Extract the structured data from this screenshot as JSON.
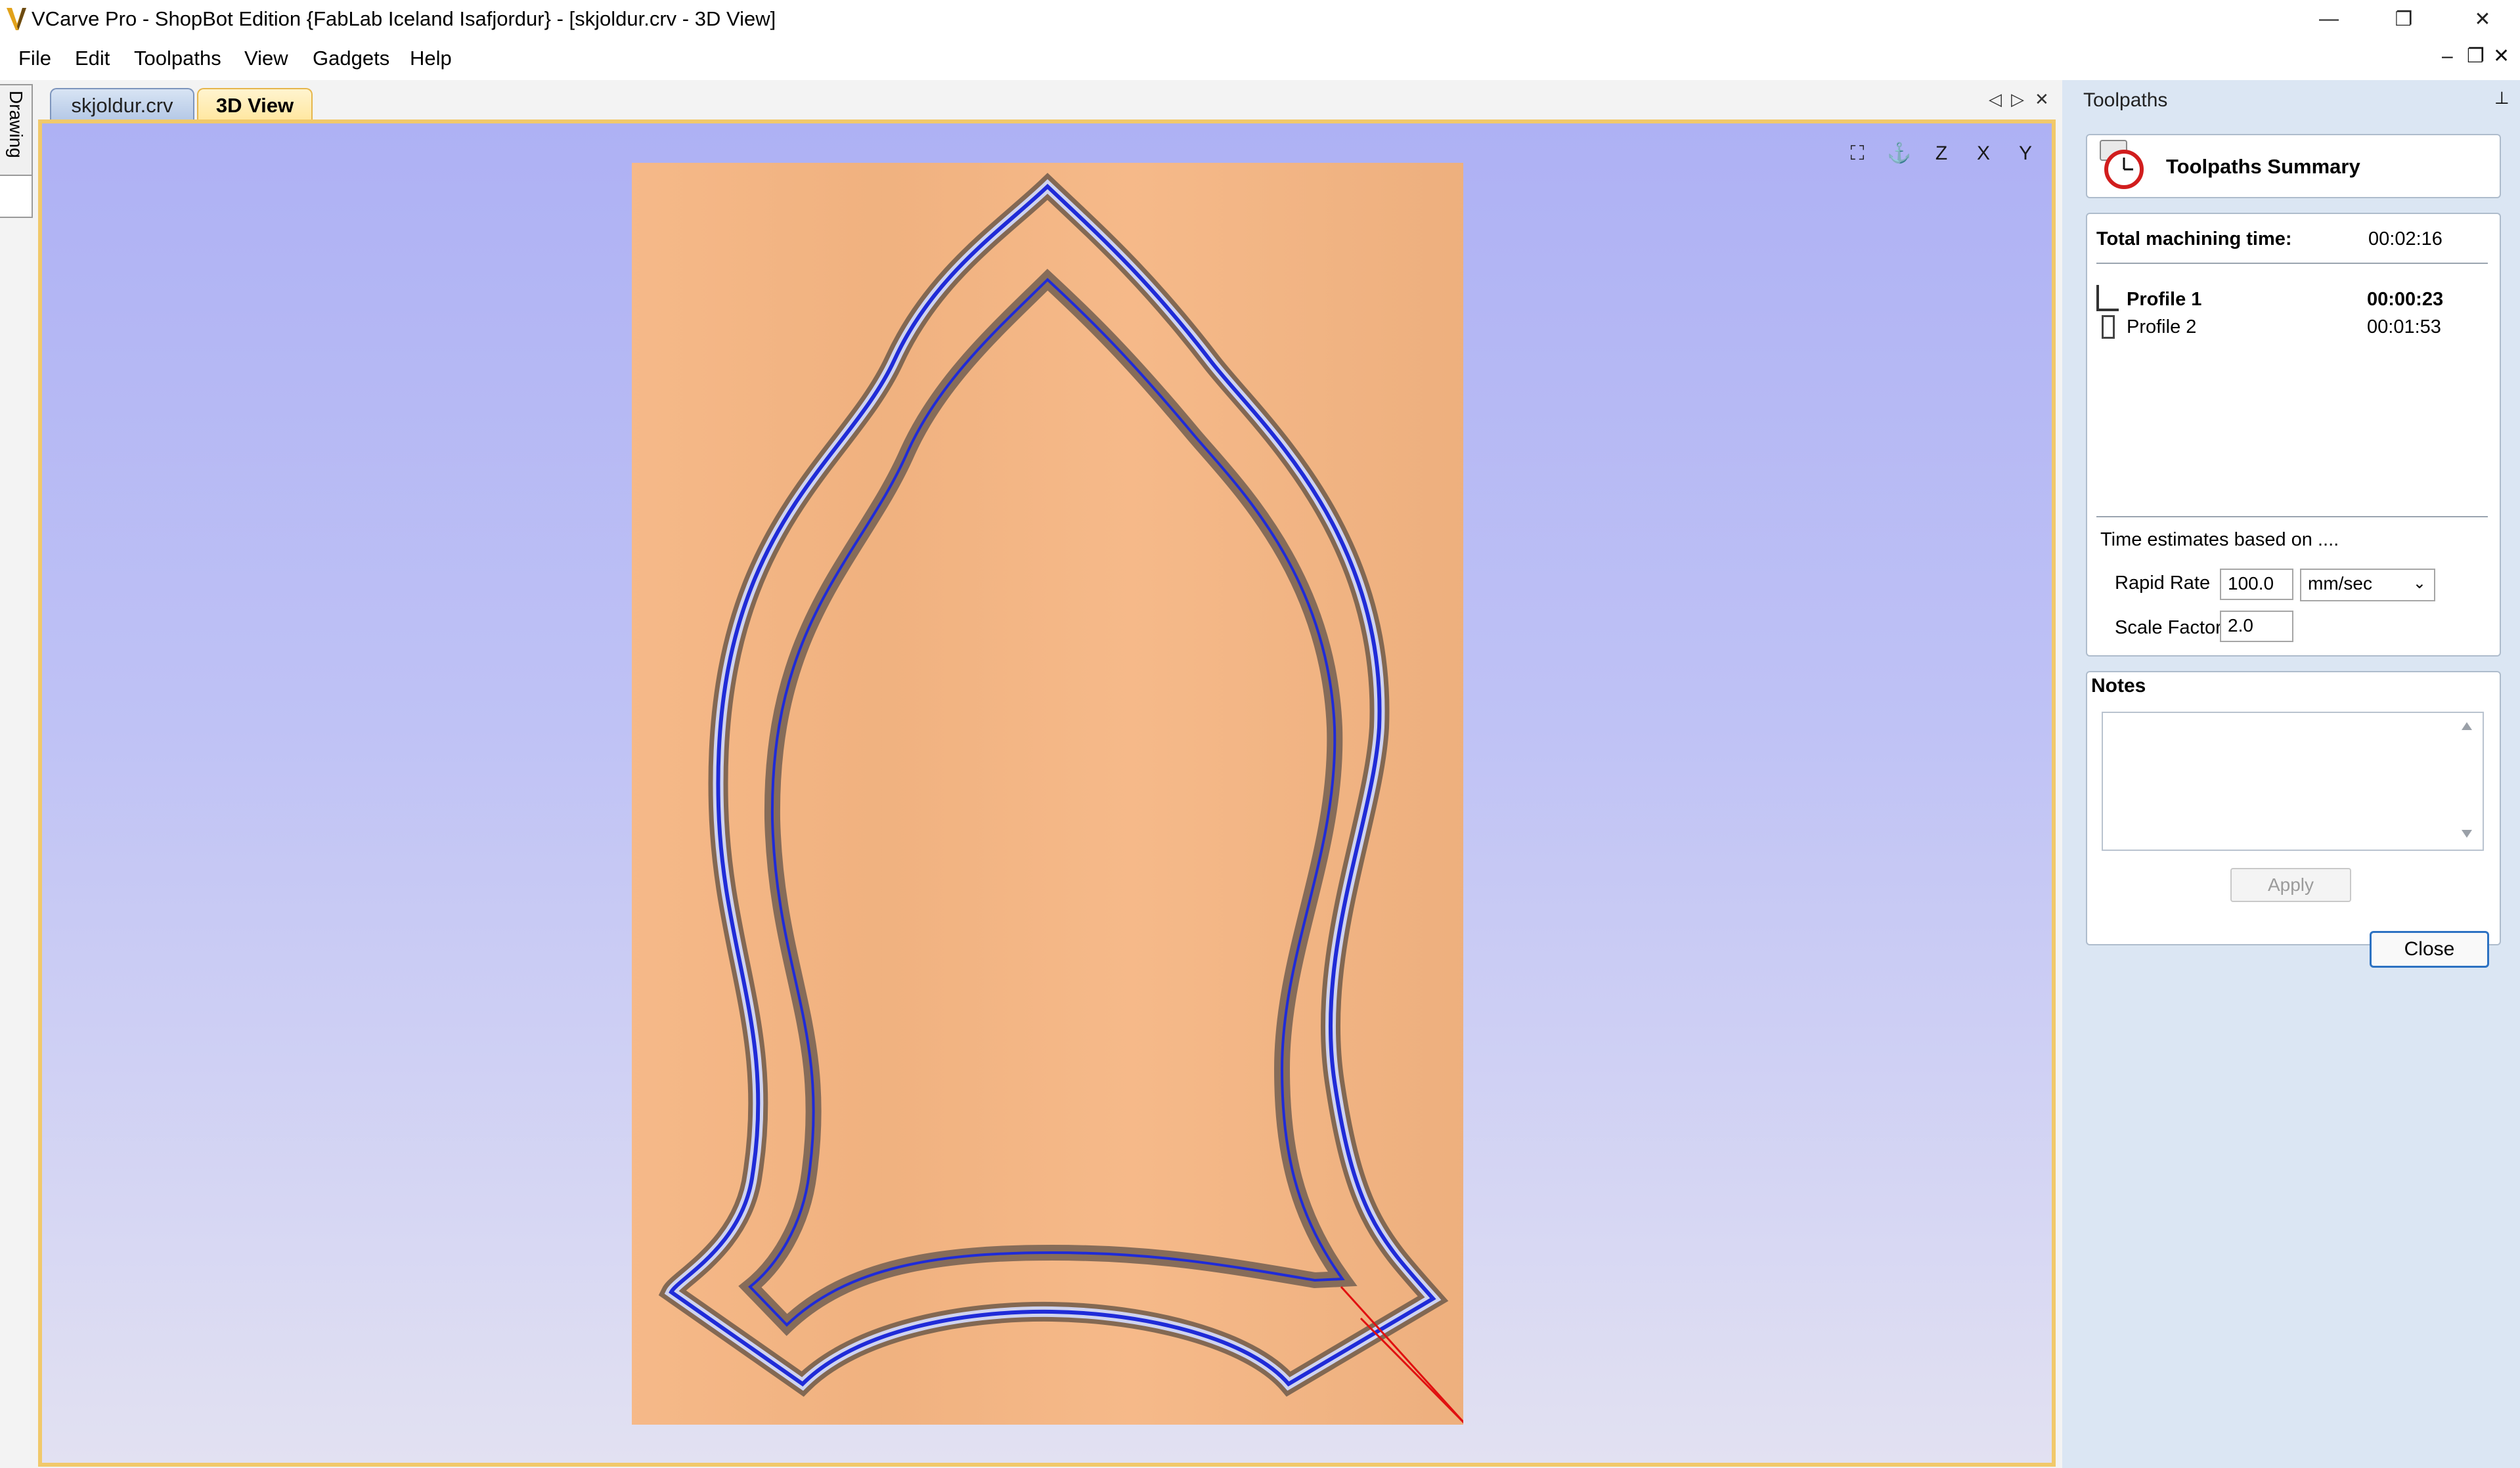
{
  "window": {
    "title": "VCarve Pro - ShopBot Edition {FabLab Iceland Isafjordur} - [skjoldur.crv - 3D View]",
    "minimize_glyph": "—",
    "maximize_glyph": "❐",
    "close_glyph": "✕"
  },
  "menu": {
    "items": [
      "File",
      "Edit",
      "Toolpaths",
      "View",
      "Gadgets",
      "Help"
    ],
    "mdi_minimize": "–",
    "mdi_restore": "❐",
    "mdi_close": "✕"
  },
  "side_tab": {
    "label": "Drawing"
  },
  "tabs": {
    "items": [
      {
        "label": "skjoldur.crv",
        "active": false
      },
      {
        "label": "3D View",
        "active": true
      }
    ],
    "nav_left": "◁",
    "nav_right": "▷",
    "close": "✕"
  },
  "view_toolbar": {
    "icons": [
      "zoom-extents-icon",
      "iso-view-icon",
      "top-view-z-icon",
      "front-view-x-icon",
      "side-view-y-icon"
    ],
    "labels": [
      "",
      "",
      "Z",
      "X",
      "Y"
    ]
  },
  "panel": {
    "header": "Toolpaths",
    "pin": "📌",
    "summary_title": "Toolpaths Summary",
    "total_label": "Total machining time:",
    "total_value": "00:02:16",
    "toolpaths": [
      {
        "name": "Profile 1",
        "time": "00:00:23",
        "selected": true
      },
      {
        "name": "Profile 2",
        "time": "00:01:53",
        "selected": false
      }
    ],
    "estimates_label": "Time estimates based on ....",
    "rapid_rate_label": "Rapid Rate",
    "rapid_rate_value": "100.0",
    "rapid_rate_unit": "mm/sec",
    "scale_factor_label": "Scale Factor",
    "scale_factor_value": "2.0",
    "notes_title": "Notes",
    "notes_value": "",
    "apply_label": "Apply",
    "close_label": "Close"
  },
  "colors": {
    "accent_tab": "#ffe7a0",
    "board": "#f5b582",
    "toolpath": "#1f2bd8",
    "background_top": "#aeb1f4",
    "background_bottom": "#e2e1f2"
  }
}
